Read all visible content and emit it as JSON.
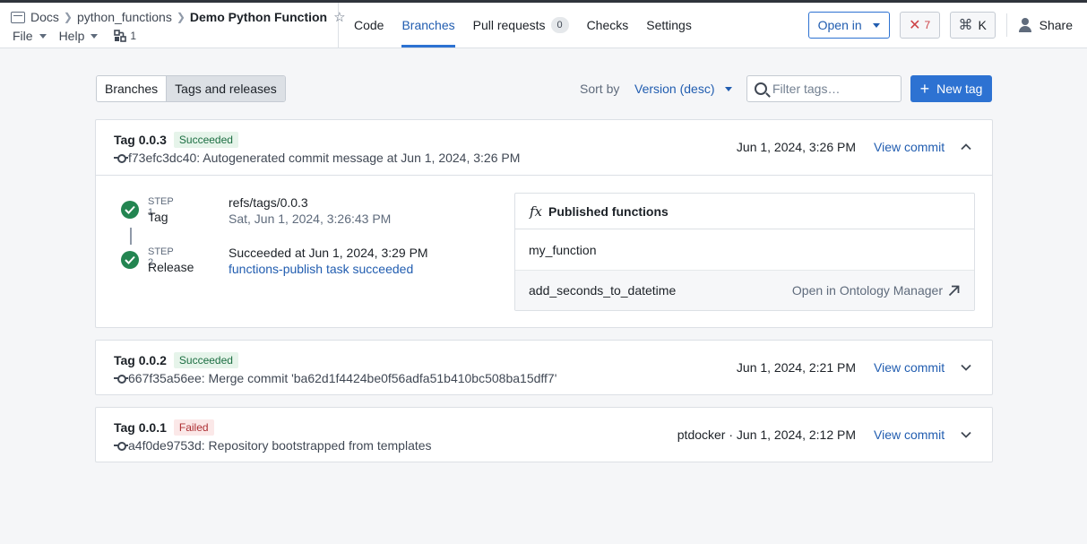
{
  "header": {
    "breadcrumbs": [
      "Docs",
      "python_functions"
    ],
    "title": "Demo Python Function",
    "menus": [
      "File",
      "Help"
    ],
    "branch_count": "1",
    "tabs": [
      {
        "label": "Code",
        "active": false
      },
      {
        "label": "Branches",
        "active": true
      },
      {
        "label": "Pull requests",
        "active": false,
        "count": "0"
      },
      {
        "label": "Checks",
        "active": false
      },
      {
        "label": "Settings",
        "active": false
      }
    ],
    "open_in": "Open in",
    "errors": "7",
    "shortcut": "K",
    "share": "Share"
  },
  "toolbar": {
    "segments": [
      "Branches",
      "Tags and releases"
    ],
    "sort_label": "Sort by",
    "sort_value": "Version (desc)",
    "filter_placeholder": "Filter tags…",
    "new_tag": "New tag"
  },
  "tags": [
    {
      "name": "Tag 0.0.3",
      "status": "Succeeded",
      "commit": "f73efc3dc40: Autogenerated commit message at Jun 1, 2024, 3:26 PM",
      "date": "Jun 1, 2024, 3:26 PM",
      "view_commit": "View commit",
      "steps": [
        {
          "label": "STEP 1",
          "name": "Tag",
          "info": "refs/tags/0.0.3",
          "sub": "Sat, Jun 1, 2024, 3:26:43 PM"
        },
        {
          "label": "STEP 2",
          "name": "Release",
          "info": "Succeeded at Jun 1, 2024, 3:29 PM",
          "link": "functions-publish task succeeded"
        }
      ],
      "published": {
        "title": "Published functions",
        "functions": [
          "my_function",
          "add_seconds_to_datetime"
        ],
        "open_in": "Open in Ontology Manager"
      }
    },
    {
      "name": "Tag 0.0.2",
      "status": "Succeeded",
      "commit": "667f35a56ee: Merge commit 'ba62d1f4424be0f56adfa51b410bc508ba15dff7'",
      "date": "Jun 1, 2024, 2:21 PM",
      "view_commit": "View commit"
    },
    {
      "name": "Tag 0.0.1",
      "status": "Failed",
      "commit": "a4f0de9753d: Repository bootstrapped from templates",
      "date": "ptdocker · Jun 1, 2024, 2:12 PM",
      "view_commit": "View commit"
    }
  ]
}
